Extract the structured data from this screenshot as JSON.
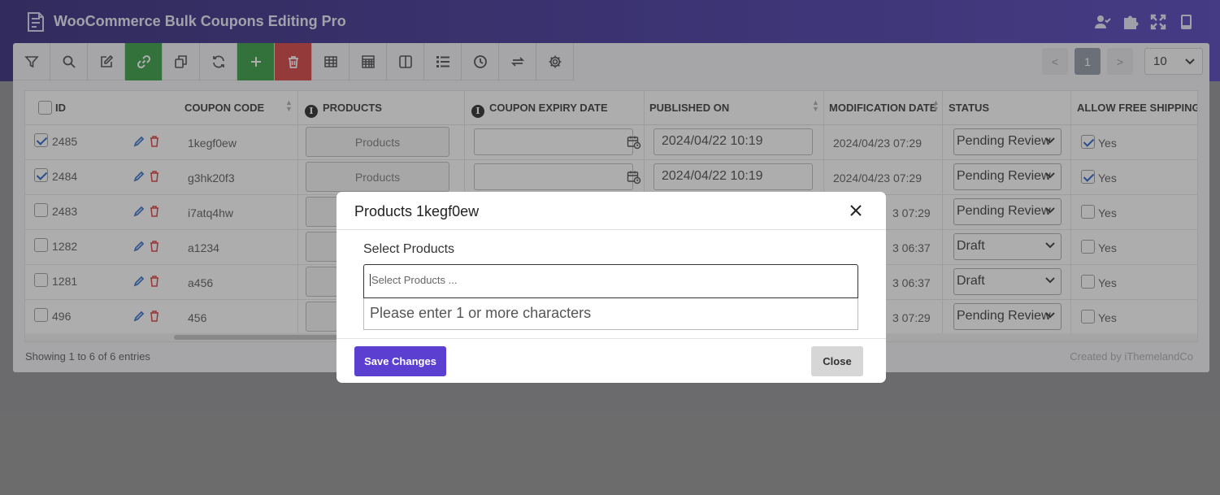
{
  "app": {
    "title": "WooCommerce Bulk Coupons Editing Pro"
  },
  "header_icons": [
    "user-check-icon",
    "puzzle-icon",
    "fullscreen-icon",
    "book-icon"
  ],
  "toolbar": {
    "buttons": [
      "filter-icon",
      "search-icon",
      "edit-icon",
      "link-icon",
      "duplicate-icon",
      "refresh-icon",
      "add-icon",
      "delete-icon",
      "table-icon",
      "grid-icon",
      "columns-icon",
      "list-icon",
      "history-icon",
      "swap-icon",
      "settings-icon"
    ],
    "colors": {
      "green": "#2f9a3a",
      "red": "#d63a3a"
    }
  },
  "pager": {
    "prev": "<",
    "current": "1",
    "next": ">",
    "per_page": "10"
  },
  "table": {
    "columns": {
      "id": "ID",
      "coupon_code": "COUPON CODE",
      "products": "PRODUCTS",
      "expiry": "COUPON EXPIRY DATE",
      "published": "PUBLISHED ON",
      "modified": "MODIFICATION DATE",
      "status": "STATUS",
      "free_shipping": "ALLOW FREE SHIPPING"
    },
    "rows": [
      {
        "id": "2485",
        "code": "1kegf0ew",
        "products_btn": "Products",
        "published": "2024/04/22 10:19",
        "modified": "2024/04/23 07:29",
        "status": "Pending Review",
        "shipping": "Yes"
      },
      {
        "id": "2484",
        "code": "g3hk20f3",
        "products_btn": "Products",
        "published": "2024/04/22 10:19",
        "modified": "2024/04/23 07:29",
        "status": "Pending Review",
        "shipping": "Yes"
      },
      {
        "id": "2483",
        "code": "i7atq4hw",
        "modified": "3 07:29",
        "status": "Pending Review",
        "shipping": "Yes"
      },
      {
        "id": "1282",
        "code": "a1234",
        "modified": "3 06:37",
        "status": "Draft",
        "shipping": "Yes"
      },
      {
        "id": "1281",
        "code": "a456",
        "modified": "3 06:37",
        "status": "Draft",
        "shipping": "Yes"
      },
      {
        "id": "496",
        "code": "456",
        "modified": "3 07:29",
        "status": "Pending Review",
        "shipping": "Yes"
      }
    ]
  },
  "footer": {
    "entries": "Showing 1 to 6 of 6 entries",
    "credit": "Created by iThemelandCo"
  },
  "modal": {
    "title": "Products 1kegf0ew",
    "select_label": "Select Products",
    "select_placeholder": "Select Products ...",
    "dropdown_msg": "Please enter 1 or more characters",
    "save_label": "Save Changes",
    "close_label": "Close",
    "accent": "#5b3fd1"
  }
}
